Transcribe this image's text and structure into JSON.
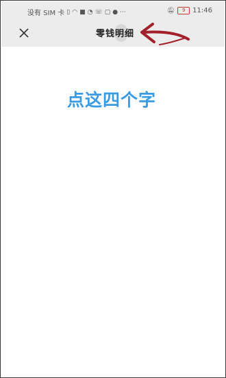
{
  "status_bar": {
    "carrier": "没有 SIM 卡",
    "time": "11:46",
    "battery_level": "9",
    "icons_left": [
      "sim-card-icon",
      "wifi-icon",
      "video-icon",
      "notification-icon",
      "phone-icon",
      "message-icon",
      "more-icon"
    ],
    "icons_right": [
      "mute-icon",
      "battery-icon"
    ]
  },
  "header": {
    "title": "零钱明细",
    "close_icon": "close-icon",
    "background": "#ececec"
  },
  "annotation": {
    "hint_text": "点这四个字",
    "hint_color": "#3a9be5",
    "arrow_color": "#a3202a"
  }
}
